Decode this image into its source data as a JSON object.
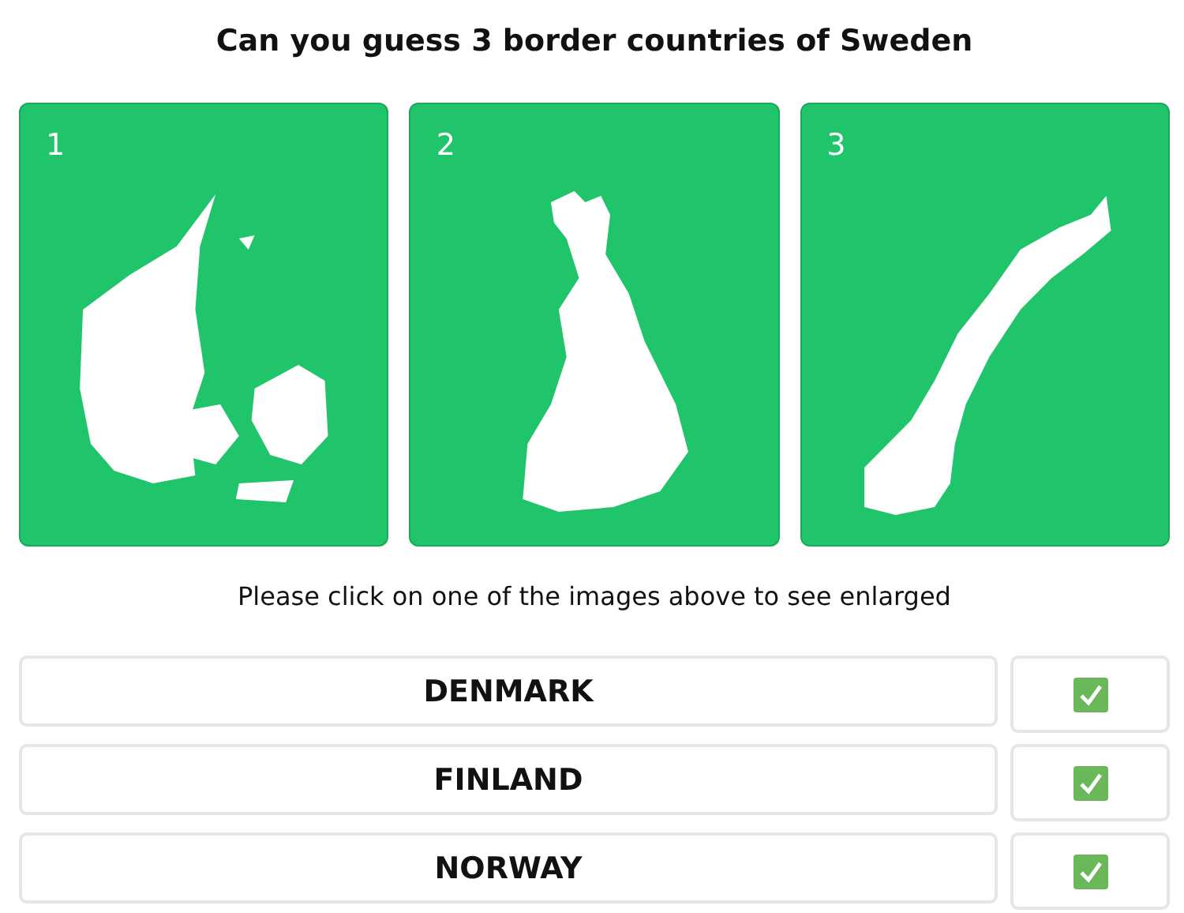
{
  "title": "Can you guess 3 border countries of Sweden",
  "cards": [
    {
      "number": "1"
    },
    {
      "number": "2"
    },
    {
      "number": "3"
    }
  ],
  "hint": "Please click on one of the images above to see enlarged",
  "answers": [
    {
      "text": "DENMARK",
      "checked": true
    },
    {
      "text": "FINLAND",
      "checked": true
    },
    {
      "text": "NORWAY",
      "checked": true
    }
  ]
}
